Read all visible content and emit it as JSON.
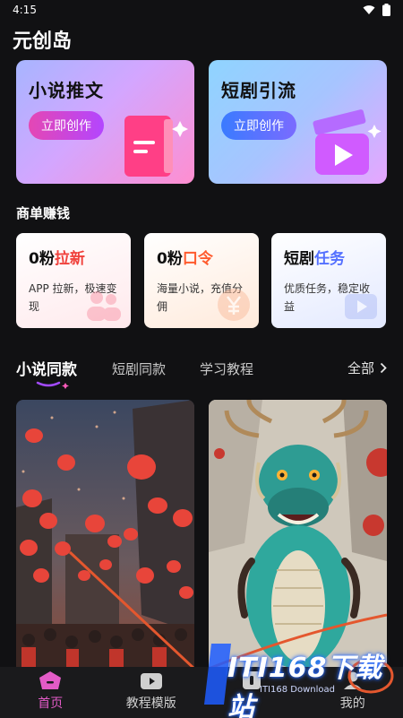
{
  "status_bar": {
    "time": "4:15"
  },
  "app": {
    "title": "元创岛"
  },
  "hero_cards": [
    {
      "title": "小说推文",
      "button": "立即创作"
    },
    {
      "title": "短剧引流",
      "button": "立即创作"
    }
  ],
  "section": {
    "title": "商单赚钱"
  },
  "task_cards": [
    {
      "title_prefix": "0粉",
      "title_highlight": "拉新",
      "desc": "APP 拉新，极速变现"
    },
    {
      "title_prefix": "0粉",
      "title_highlight": "口令",
      "desc": "海量小说，充值分佣"
    },
    {
      "title_prefix": "短剧",
      "title_highlight": "任务",
      "desc": "优质任务，稳定收益"
    }
  ],
  "tabs": {
    "items": [
      "小说同款",
      "短剧同款",
      "学习教程"
    ],
    "all": "全部"
  },
  "bottom_nav": {
    "items": [
      "首页",
      "教程模版",
      "",
      "我的"
    ]
  },
  "watermark": {
    "text": "ITI168下载站",
    "sub": "ITI168 Download"
  },
  "colors": {
    "accent": "#e35bc7",
    "background": "#111113",
    "red": "#f0413c",
    "orange": "#ff5b2e",
    "blue": "#5470ff"
  }
}
